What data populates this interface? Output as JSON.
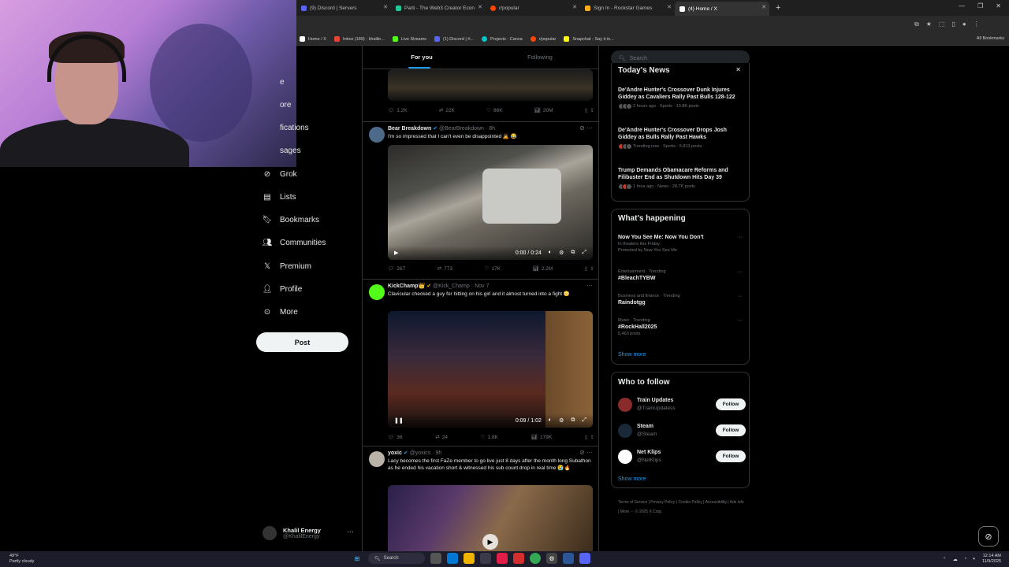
{
  "browser": {
    "tabs": [
      {
        "title": "(9) Discord | Servers",
        "color": "#5865f2",
        "active": false
      },
      {
        "title": "Parti - The Web3 Creator Econ",
        "color": "#20c997",
        "active": false
      },
      {
        "title": "r/popular",
        "color": "#ff4500",
        "active": false
      },
      {
        "title": "Sign In - Rockstar Games",
        "color": "#fcaf17",
        "active": false
      },
      {
        "title": "(4) Home / X",
        "color": "#ffffff",
        "active": true
      }
    ],
    "bookmarks": [
      "Home / X",
      "Inbox (189) - khalile...",
      "Live Streams",
      "(1) Discord | #...",
      "Projects - Canva",
      "r/popular",
      "Snapchat - Say it in..."
    ],
    "all_bookmarks": "All Bookmarks"
  },
  "nav": {
    "items": [
      {
        "label": "e",
        "icon": "home-icon"
      },
      {
        "label": "ore",
        "icon": "explore-icon"
      },
      {
        "label": "fications",
        "icon": "notifications-icon"
      },
      {
        "label": "sages",
        "icon": "messages-icon"
      },
      {
        "label": "Grok",
        "icon": "grok-icon"
      },
      {
        "label": "Lists",
        "icon": "lists-icon"
      },
      {
        "label": "Bookmarks",
        "icon": "bookmark-icon"
      },
      {
        "label": "Communities",
        "icon": "communities-icon"
      },
      {
        "label": "Premium",
        "icon": "x-logo-icon"
      },
      {
        "label": "Profile",
        "icon": "profile-icon"
      },
      {
        "label": "More",
        "icon": "more-circle-icon"
      }
    ],
    "post_label": "Post",
    "account": {
      "name": "Khalil Energy",
      "handle": "@KhalilEnergy"
    }
  },
  "feed": {
    "tabs": [
      "For you",
      "Following"
    ],
    "top_actions": {
      "replies": "1.2K",
      "reposts": "22K",
      "likes": "86K",
      "views": "20M"
    },
    "tweets": [
      {
        "name": "Bear Breakdown",
        "handle": "@BearBreakdown",
        "time": "8h",
        "text": "I'm so impressed that I can't even be disappointed 🙇 😂",
        "video_time": "0:00 / 0:24",
        "replies": "267",
        "reposts": "773",
        "likes": "17K",
        "views": "2.2M"
      },
      {
        "name": "KickChamp👑",
        "handle": "@Kick_Champ",
        "time": "Nov 7",
        "text": "Clavicular checked a guy for hitting on his girl and it almost turned into a fight 😳",
        "video_time": "0:09 / 1:02",
        "replies": "36",
        "reposts": "24",
        "likes": "1.8K",
        "views": "179K"
      },
      {
        "name": "yoxic",
        "handle": "@yoxics",
        "time": "9h",
        "text": "Lacy becomes the first FaZe member to go live just 8 days after the month long Subathon as he ended his vacation short & witnessed his sub count drop in real time 😭🔥"
      }
    ]
  },
  "sidebar": {
    "search_placeholder": "Search",
    "news": {
      "title": "Today's News",
      "items": [
        {
          "headline": "De'Andre Hunter's Crossover Dunk Injures Giddey as Cavaliers Rally Past Bulls 128-122",
          "meta": "2 hours ago · Sports · 13.8K posts"
        },
        {
          "headline": "De'Andre Hunter's Crossover Drops Josh Giddey as Bulls Rally Past Hawks",
          "meta": "Trending now · Sports · 5,813 posts"
        },
        {
          "headline": "Trump Demands Obamacare Reforms and Filibuster End as Shutdown Hits Day 39",
          "meta": "1 hour ago · News · 28.7K posts"
        }
      ]
    },
    "happening": {
      "title": "What's happening",
      "items": [
        {
          "context": "",
          "name": "Now You See Me: Now You Don't",
          "sub": "In theaters this Friday.",
          "sub2": "Promoted by Now You See Me"
        },
        {
          "context": "Entertainment · Trending",
          "name": "#BleachTYBW",
          "sub": "",
          "sub2": ""
        },
        {
          "context": "Business and finance · Trending",
          "name": "Raindotgg",
          "sub": "",
          "sub2": ""
        },
        {
          "context": "Music · Trending",
          "name": "#RockHall2025",
          "sub": "5,463 posts",
          "sub2": ""
        }
      ],
      "show_more": "Show more"
    },
    "who_to_follow": {
      "title": "Who to follow",
      "items": [
        {
          "name": "Train Updates",
          "handle": "@TrainUpdatess",
          "button": "Follow"
        },
        {
          "name": "Steam",
          "handle": "@Steam",
          "button": "Follow"
        },
        {
          "name": "Net Klips",
          "handle": "@NetKlips",
          "button": "Follow"
        }
      ],
      "show_more": "Show more"
    },
    "footer": "Terms of Service | Privacy Policy | Cookie Policy | Accessibility | Ads info | More ··· © 2025 X Corp."
  },
  "taskbar": {
    "weather_temp": "49°F",
    "weather_desc": "Partly cloudy",
    "search_label": "Search",
    "time": "12:14 AM",
    "date": "11/9/2025"
  }
}
